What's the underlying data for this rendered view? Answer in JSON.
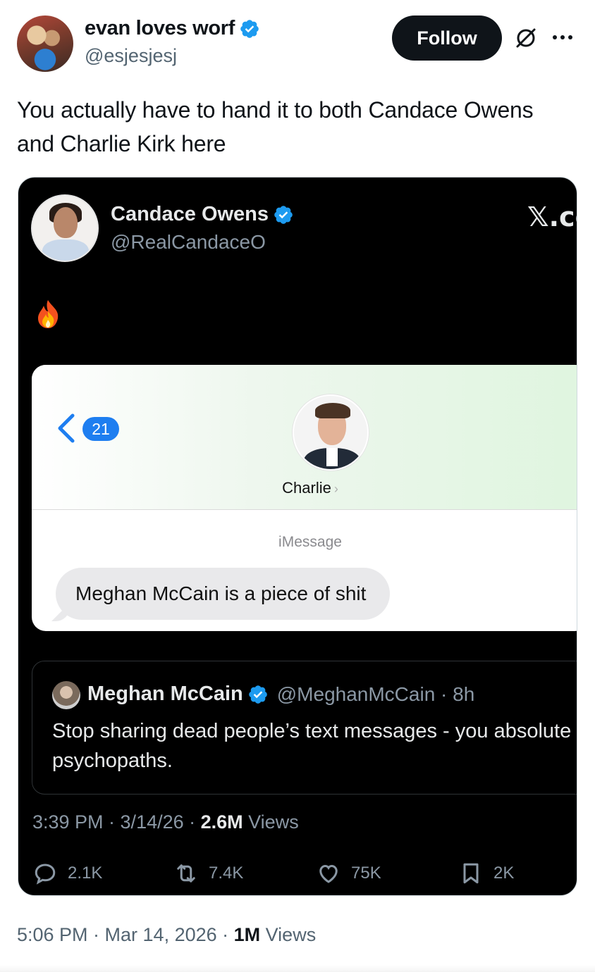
{
  "author": {
    "display_name": "evan loves worf",
    "handle": "@esjesjesj",
    "verified": true
  },
  "follow_label": "Follow",
  "tweet_text": "You actually have to hand it to both Candace Owens and Charlie Kirk here",
  "embedded": {
    "display_name": "Candace Owens",
    "handle": "@RealCandaceO",
    "x_logo": "𝕏.co",
    "text_icon": "fire-emoji",
    "imessage": {
      "back_count": "21",
      "contact_name": "Charlie",
      "service_label": "iMessage",
      "message": "Meghan McCain is a piece of shit"
    },
    "quote": {
      "display_name": "Meghan McCain",
      "handle_time": "@MeghanMcCain · 8h",
      "text": "Stop sharing dead people’s text messages - you absolute psychopaths."
    },
    "timestamp": "3:39 PM · 3/14/26 · ",
    "views_count": "2.6M",
    "views_label": " Views",
    "stats": {
      "replies": "2.1K",
      "reposts": "7.4K",
      "likes": "75K",
      "bookmarks": "2K"
    }
  },
  "footer": {
    "timestamp": "5:06 PM · Mar 14, 2026 · ",
    "views_count": "1M",
    "views_label": " Views"
  },
  "colors": {
    "verified_blue": "#1d9bf0",
    "imessage_blue": "#1e7ef0",
    "dark_bg": "#000000",
    "muted": "#536471"
  }
}
